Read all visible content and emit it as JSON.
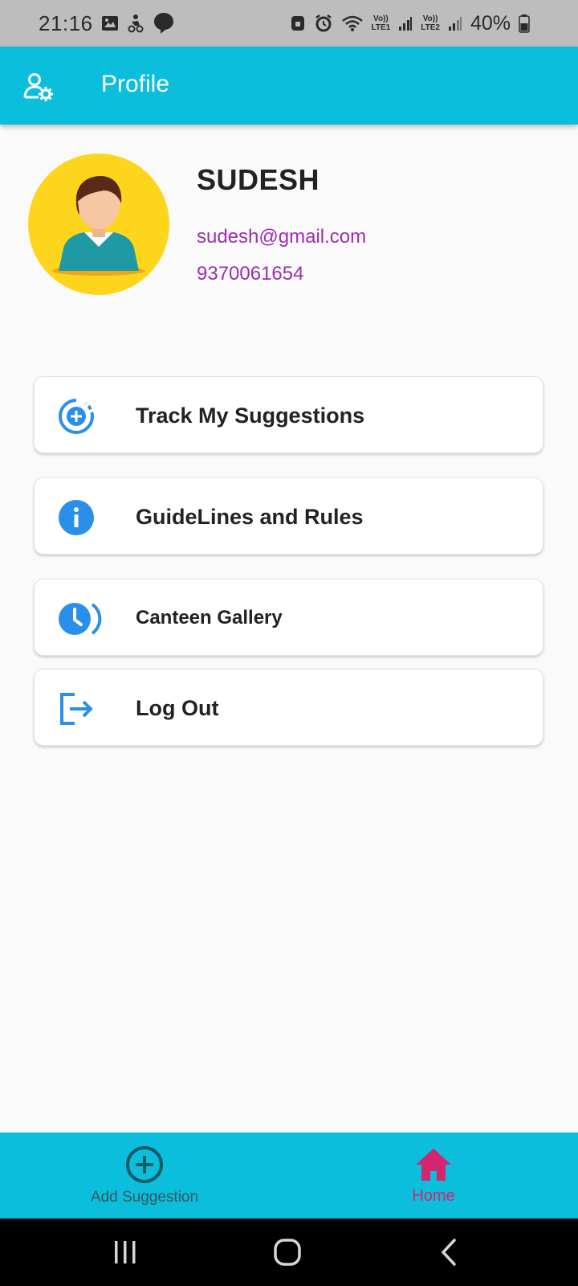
{
  "status_bar": {
    "time": "21:16",
    "battery_percent": "40%",
    "left_icons": [
      "gallery-icon",
      "bike-icon",
      "speech-icon"
    ],
    "right_icons": [
      "vpn-icon",
      "alarm-icon",
      "wifi-icon",
      "lte1-icon",
      "signal-icon",
      "lte2-icon",
      "signal-icon",
      "battery-icon"
    ],
    "lte1_label": "LTE1",
    "lte2_label": "LTE2",
    "volte_label": "Vo))"
  },
  "app_bar": {
    "title": "Profile",
    "icon": "user-settings-icon"
  },
  "profile": {
    "name": "SUDESH",
    "email": "sudesh@gmail.com",
    "phone": "9370061654"
  },
  "menu": [
    {
      "label": "Track My Suggestions",
      "icon": "target-plus-icon"
    },
    {
      "label": "GuideLines and Rules",
      "icon": "info-icon"
    },
    {
      "label": "Canteen Gallery",
      "icon": "clock-icon"
    },
    {
      "label": "Log Out",
      "icon": "logout-icon"
    }
  ],
  "bottom_nav": {
    "items": [
      {
        "label": "Add Suggestion",
        "icon": "add-circle-icon",
        "active": false
      },
      {
        "label": "Home",
        "icon": "home-icon",
        "active": true
      }
    ]
  },
  "colors": {
    "accent": "#0bbfdc",
    "link_purple": "#9c2fae",
    "icon_blue": "#2a8fe8",
    "active_pink": "#d3266f",
    "avatar_bg": "#fdd51c"
  }
}
